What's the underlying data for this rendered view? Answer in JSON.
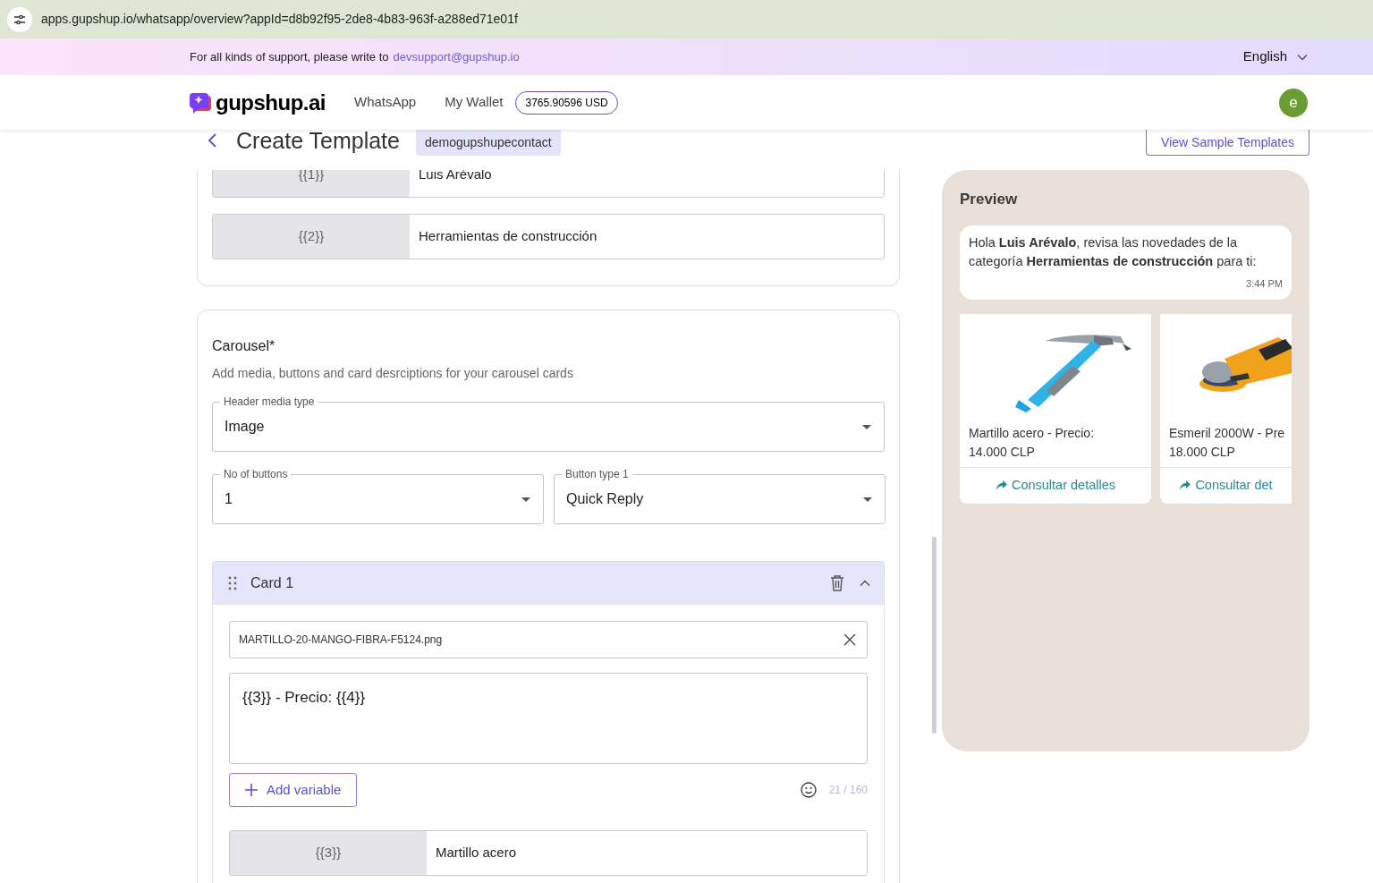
{
  "browser": {
    "url": "apps.gupshup.io/whatsapp/overview?appId=d8b92f95-2de8-4b83-963f-a288ed71e01f"
  },
  "support_bar": {
    "text": "For all kinds of support, please write to",
    "email": "devsupport@gupshup.io",
    "language": "English"
  },
  "header": {
    "logo": "gupshup.ai",
    "nav": [
      "WhatsApp",
      "My Wallet"
    ],
    "balance": "3765.90596 USD",
    "avatar": "e"
  },
  "title_row": {
    "title": "Create Template",
    "app_name": "demogupshupecontact",
    "sample_button": "View Sample Templates"
  },
  "variables": [
    {
      "placeholder": "{{1}}",
      "value": "Luis Arévalo"
    },
    {
      "placeholder": "{{2}}",
      "value": "Herramientas de construcción"
    }
  ],
  "carousel": {
    "title": "Carousel*",
    "subtitle": "Add media, buttons and card desrciptions for your carousel cards",
    "header_media_type": {
      "label": "Header media type",
      "value": "Image"
    },
    "no_of_buttons": {
      "label": "No of buttons",
      "value": "1"
    },
    "button_type": {
      "label": "Button type 1",
      "value": "Quick Reply"
    },
    "cards": [
      {
        "title": "Card 1",
        "expanded": true,
        "file": "MARTILLO-20-MANGO-FIBRA-F5124.png",
        "body": "{{3}} - Precio: {{4}}",
        "add_variable": "Add variable",
        "counter": "21 / 160",
        "variables": [
          {
            "placeholder": "{{3}}",
            "value": "Martillo acero"
          }
        ]
      }
    ]
  },
  "preview": {
    "title": "Preview",
    "message": "Hola **Luis Arévalo**, revisa las novedades de la categoría **Herramientas de construcción** para ti:",
    "time": "3:44 PM",
    "cards": [
      {
        "kind": "picture",
        "text_lines": [
          "Martillo acero - Precio:",
          "14.000 CLP"
        ],
        "button": "Consultar detalles"
      },
      {
        "kind": "picture",
        "text_lines": [
          "Esmeril 2000W - Pre",
          "18.000 CLP"
        ],
        "button": "Consultar det"
      }
    ]
  }
}
